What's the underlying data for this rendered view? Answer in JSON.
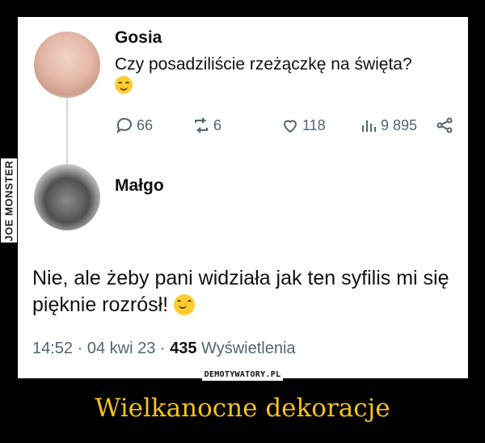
{
  "tweet": {
    "author": "Gosia",
    "text": "Czy posadziliście rzeżączkę na święta?",
    "stats": {
      "replies": "66",
      "reposts": "6",
      "likes": "118",
      "views": "9 895"
    }
  },
  "reply": {
    "author": "Małgo",
    "text": "Nie, ale żeby pani widziała jak ten syfilis mi się pięknie rozrósł!",
    "time": "14:52 · 04 kwi 23 · ",
    "views_count": "435",
    "views_label": " Wyświetlenia"
  },
  "watermark": {
    "side": "JOE MONSTER",
    "site": "DEMOTYWATORY.PL"
  },
  "caption": "Wielkanocne dekoracje",
  "colors": {
    "caption": "#f4c21a",
    "muted": "#536471",
    "background": "#000000"
  },
  "icons": [
    "reply-icon",
    "repost-icon",
    "like-icon",
    "views-icon",
    "share-icon",
    "smile-emoji",
    "hug-emoji"
  ]
}
